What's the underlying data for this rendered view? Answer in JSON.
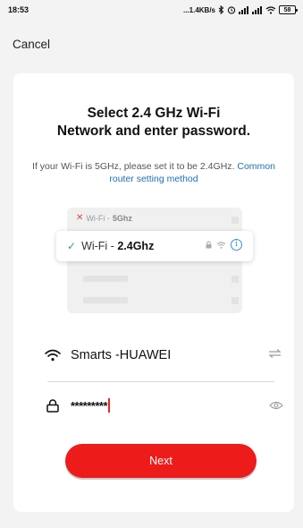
{
  "status_bar": {
    "time": "18:53",
    "net_speed": "...1.4KB/s",
    "battery": "58"
  },
  "header": {
    "cancel_label": "Cancel"
  },
  "card": {
    "title_line1": "Select 2.4 GHz Wi-Fi",
    "title_line2": "Network and enter password.",
    "desc_text": "If your Wi-Fi is 5GHz, please set it to be 2.4GHz.",
    "desc_link": "Common router setting method"
  },
  "illustration": {
    "row1_prefix": "Wi-Fi - ",
    "row1_band": "5Ghz",
    "row2_prefix": "Wi-Fi - ",
    "row2_band": "2.4Ghz"
  },
  "form": {
    "wifi_name": "Smarts -HUAWEI",
    "password_masked": "*********"
  },
  "actions": {
    "next_label": "Next"
  },
  "colors": {
    "accent": "#ee1b1b",
    "link": "#1f6fb3",
    "check": "#2fa84f"
  },
  "icons": [
    "bluetooth-icon",
    "alarm-icon",
    "signal-icon",
    "wifi-icon",
    "battery-icon",
    "swap-icon",
    "lock-icon",
    "eye-icon",
    "info-icon",
    "check-icon",
    "x-icon"
  ]
}
